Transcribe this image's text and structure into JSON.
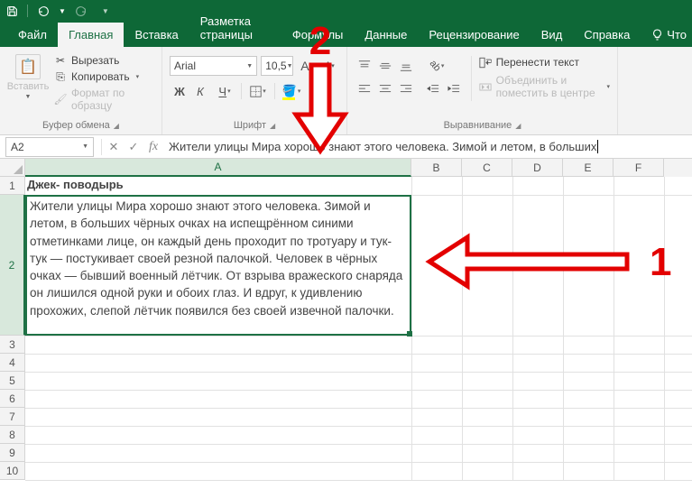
{
  "titlebar": {
    "icons": [
      "save",
      "undo",
      "redo"
    ]
  },
  "tabs": {
    "file": "Файл",
    "home": "Главная",
    "insert": "Вставка",
    "pagelayout": "Разметка страницы",
    "formulas": "Формулы",
    "data": "Данные",
    "review": "Рецензирование",
    "view": "Вид",
    "help": "Справка",
    "tell": "Что"
  },
  "clipboard": {
    "paste": "Вставить",
    "cut": "Вырезать",
    "copy": "Копировать",
    "format": "Формат по образцу",
    "group": "Буфер обмена"
  },
  "font": {
    "name": "Arial",
    "size": "10,5",
    "group": "Шрифт",
    "bold": "Ж",
    "italic": "К",
    "underline": "Ч"
  },
  "alignment": {
    "wrap": "Перенести текст",
    "merge": "Объединить и поместить в центре",
    "group": "Выравнивание"
  },
  "formula": {
    "cellref": "A2",
    "content": "Жители улицы Мира хорошо знают этого человека. Зимой и летом, в больших"
  },
  "sheet": {
    "cols": [
      "A",
      "B",
      "C",
      "D",
      "E",
      "F"
    ],
    "rows": [
      "1",
      "2",
      "3",
      "4",
      "5",
      "6",
      "7",
      "8",
      "9",
      "10"
    ],
    "a1": "Джек- поводырь",
    "a2": "Жители улицы Мира хорошо знают этого человека. Зимой и летом, в больших чёрных очках на испещрённом синими отметинками лице, он каждый день проходит по тротуару и тук-тук — постукивает своей резной палочкой. Человек в чёрных очках — бывший военный лётчик. От взрыва вражеского снаряда он лишился одной руки и обоих глаз. И вдруг, к удивлению прохожих, слепой лётчик появился без своей извечной палочки."
  },
  "annotations": {
    "n1": "1",
    "n2": "2"
  }
}
